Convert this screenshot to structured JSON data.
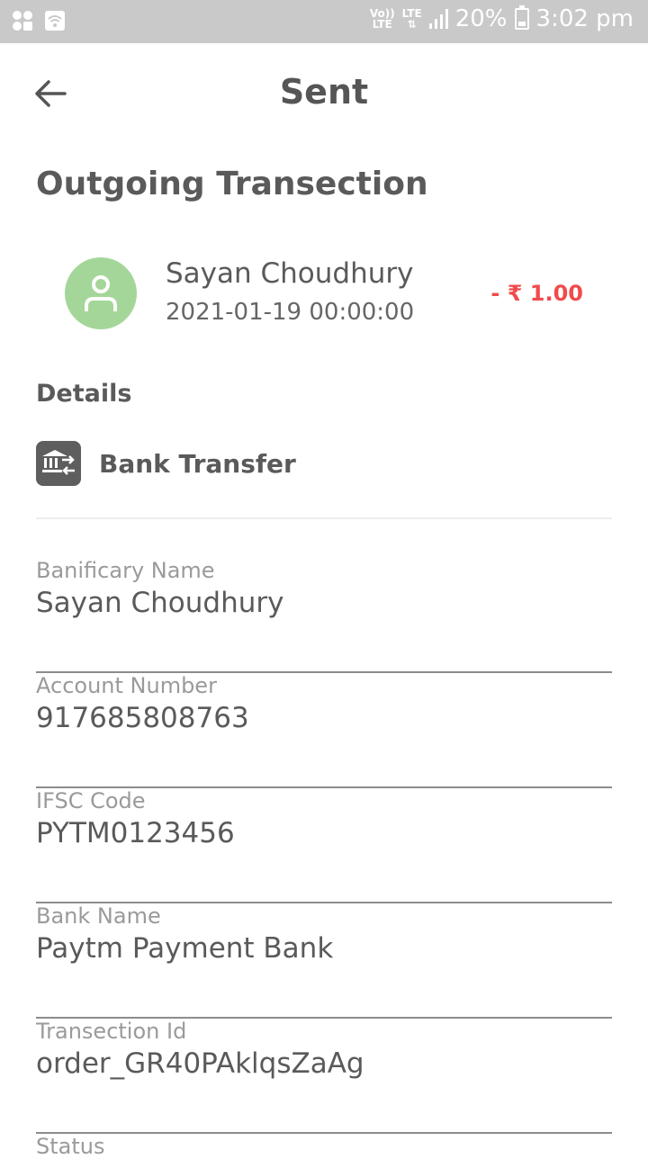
{
  "status_bar": {
    "network_top": "Vo))",
    "network_bottom": "LTE",
    "lte_label": "LTE",
    "battery_percent": "20%",
    "time": "3:02 pm"
  },
  "app_bar": {
    "title": "Sent"
  },
  "section_heading": "Outgoing Transection",
  "transaction": {
    "name": "Sayan Choudhury",
    "datetime": "2021-01-19 00:00:00",
    "amount": "- ₹ 1.00",
    "amount_color": "#f04b4b",
    "avatar_color": "#a5d699"
  },
  "details": {
    "heading": "Details",
    "method": "Bank Transfer",
    "method_icon": "bank-transfer-icon"
  },
  "fields": [
    {
      "label": "Banificary Name",
      "value": "Sayan Choudhury"
    },
    {
      "label": "Account Number",
      "value": "917685808763"
    },
    {
      "label": "IFSC Code",
      "value": "PYTM0123456"
    },
    {
      "label": "Bank Name",
      "value": "Paytm Payment Bank"
    },
    {
      "label": "Transection Id",
      "value": "order_GR40PAklqsZaAg"
    },
    {
      "label": "Status",
      "value": ""
    }
  ]
}
